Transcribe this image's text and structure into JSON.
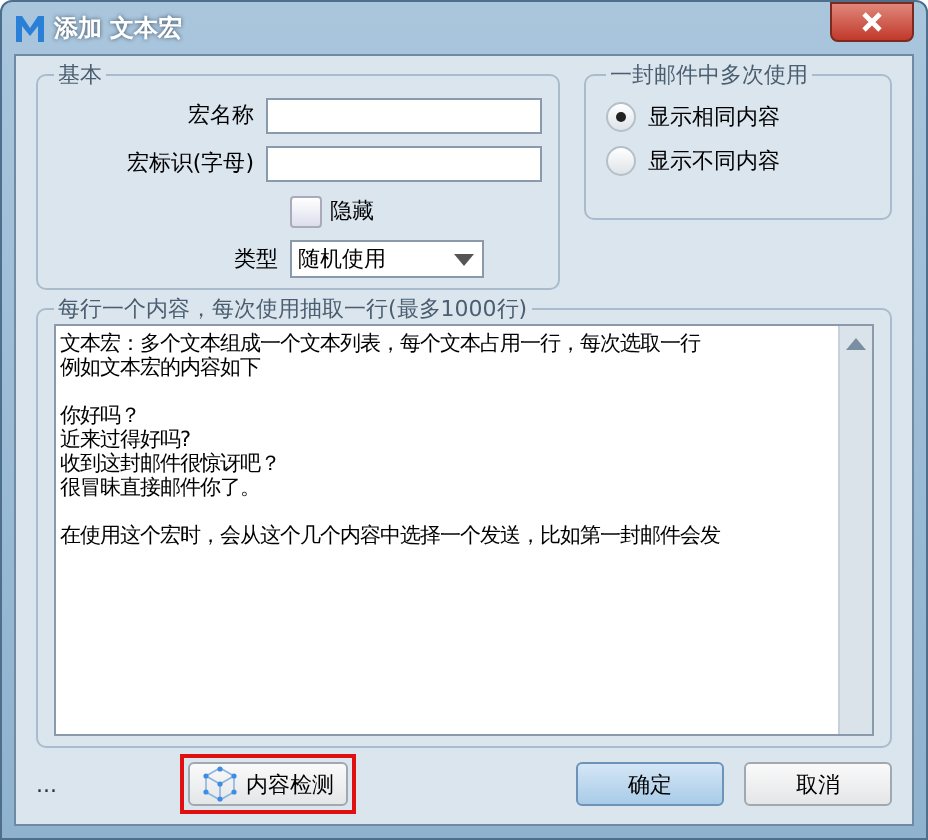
{
  "window": {
    "title": "添加 文本宏"
  },
  "basic": {
    "title": "基本",
    "fields": [
      {
        "label": "宏名称"
      },
      {
        "label": "宏标识(字母)"
      }
    ],
    "hidden": {
      "label": "隐藏",
      "checked": false
    },
    "type": {
      "label": "类型",
      "value": "随机使用"
    }
  },
  "multi_use": {
    "title": "一封邮件中多次使用",
    "options": [
      {
        "label": "显示相同内容",
        "selected": true
      },
      {
        "label": "显示不同内容",
        "selected": false
      }
    ]
  },
  "content": {
    "title": "每行一个内容，每次使用抽取一行(最多1000行)",
    "paragraphs": [
      [
        "文本宏：多个文本组成一个文本列表，每个文本占用一行，每次选取一行",
        "例如文本宏的内容如下"
      ],
      [
        "你好吗？",
        "近来过得好吗?",
        "收到这封邮件很惊讶吧？",
        "很冒昧直接邮件你了。"
      ],
      [
        "在使用这个宏时，会从这个几个内容中选择一个发送，比如第一封邮件会发"
      ]
    ]
  },
  "footer": {
    "ellipsis": "...",
    "check_button": {
      "label": "内容检测",
      "highlighted": true
    },
    "buttons": [
      {
        "label": "确定",
        "kind": "primary"
      },
      {
        "label": "取消",
        "kind": "normal"
      }
    ]
  }
}
